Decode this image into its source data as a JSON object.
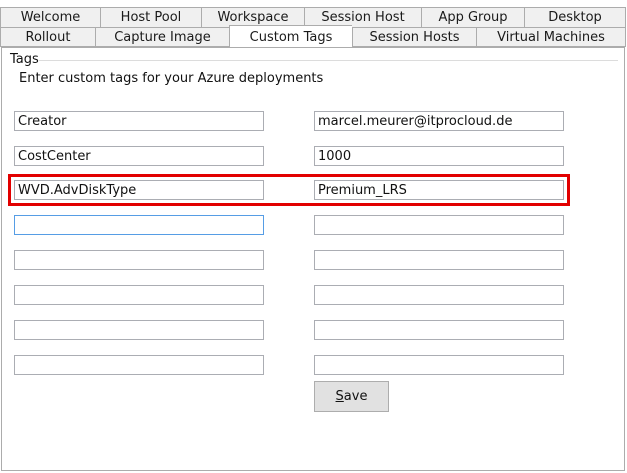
{
  "tabs_row1": [
    {
      "label": "Welcome"
    },
    {
      "label": "Host Pool"
    },
    {
      "label": "Workspace"
    },
    {
      "label": "Session Host"
    },
    {
      "label": "App Group"
    },
    {
      "label": "Desktop"
    }
  ],
  "tabs_row2": [
    {
      "label": "Rollout"
    },
    {
      "label": "Capture Image"
    },
    {
      "label": "Custom Tags",
      "active": true
    },
    {
      "label": "Session Hosts"
    },
    {
      "label": "Virtual Machines"
    }
  ],
  "group": {
    "label": "Tags",
    "intro": "Enter custom tags for your Azure deployments"
  },
  "tags": [
    {
      "key": "Creator",
      "value": "marcel.meurer@itprocloud.de"
    },
    {
      "key": "CostCenter",
      "value": "1000"
    },
    {
      "key": "WVD.AdvDiskType",
      "value": "Premium_LRS"
    },
    {
      "key": "",
      "value": ""
    },
    {
      "key": "",
      "value": ""
    },
    {
      "key": "",
      "value": ""
    },
    {
      "key": "",
      "value": ""
    },
    {
      "key": "",
      "value": ""
    }
  ],
  "save": {
    "accel": "S",
    "rest": "ave"
  },
  "colors": {
    "highlight": "#e20000",
    "focus_border": "#569de5"
  }
}
